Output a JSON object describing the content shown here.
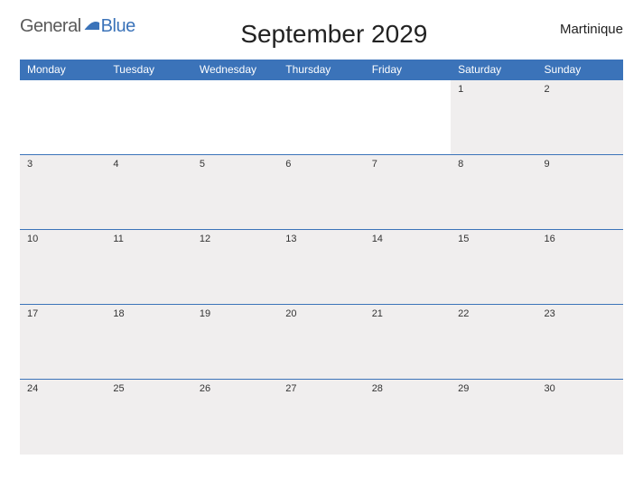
{
  "header": {
    "logo_general": "General",
    "logo_blue": "Blue",
    "title": "September 2029",
    "region": "Martinique"
  },
  "calendar": {
    "day_headers": [
      "Monday",
      "Tuesday",
      "Wednesday",
      "Thursday",
      "Friday",
      "Saturday",
      "Sunday"
    ],
    "weeks": [
      [
        "",
        "",
        "",
        "",
        "",
        "1",
        "2"
      ],
      [
        "3",
        "4",
        "5",
        "6",
        "7",
        "8",
        "9"
      ],
      [
        "10",
        "11",
        "12",
        "13",
        "14",
        "15",
        "16"
      ],
      [
        "17",
        "18",
        "19",
        "20",
        "21",
        "22",
        "23"
      ],
      [
        "24",
        "25",
        "26",
        "27",
        "28",
        "29",
        "30"
      ]
    ]
  }
}
